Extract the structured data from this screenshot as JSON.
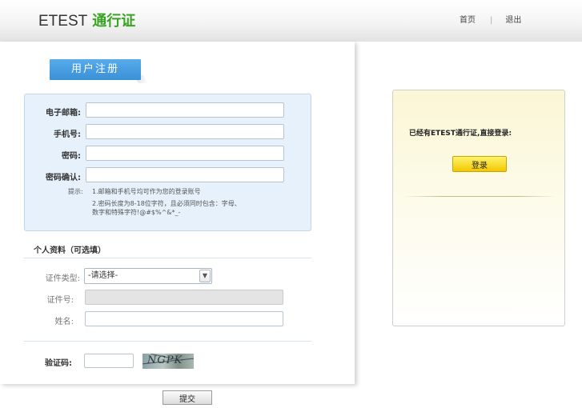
{
  "header": {
    "brand_name": "ETEST",
    "brand_pass": "通行证",
    "nav": {
      "home": "首页",
      "sep": "|",
      "logout": "退出"
    }
  },
  "register": {
    "tab_title": "用户注册",
    "email_label": "电子邮箱:",
    "phone_label": "手机号:",
    "password_label": "密码:",
    "confirm_label": "密码确认:",
    "email_value": "",
    "phone_value": "",
    "password_value": "",
    "confirm_value": "",
    "hint_prefix": "提示:",
    "hint_1": "1.邮箱和手机号均可作为您的登录账号",
    "hint_2a": "2.密码长度为8-18位字符，且必须同时包含：字母、",
    "hint_2b": "数字和特殊字符!@#$%^&*_-"
  },
  "profile": {
    "section_title": "个人资料（可选填）",
    "id_type_label": "证件类型:",
    "id_type_selected": "-请选择-",
    "id_number_label": "证件号:",
    "id_number_value": "",
    "name_label": "姓名:",
    "name_value": ""
  },
  "captcha": {
    "label": "验证码:",
    "input_value": "",
    "image_text": "NGPK"
  },
  "submit_label": "提交",
  "login_panel": {
    "text": "已经有ETEST通行证,直接登录:",
    "button_label": "登录"
  },
  "icons": {
    "select_arrow": "chevron-down-icon"
  },
  "colors": {
    "accent_blue": "#3b8fd6",
    "brand_green": "#3aa321",
    "login_yellow": "#f2c800"
  }
}
